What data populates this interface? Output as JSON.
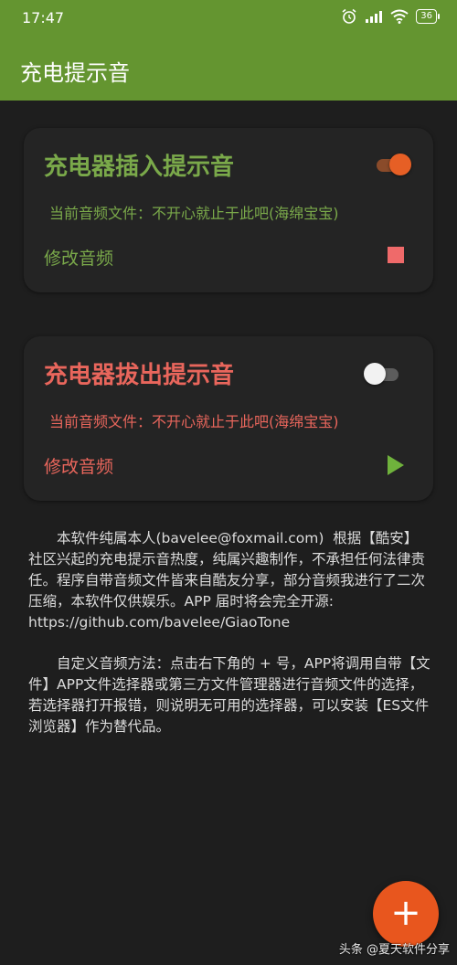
{
  "status_bar": {
    "time": "17:47",
    "alarm_icon": "alarm-icon",
    "signal_icon": "signal-icon",
    "wifi_icon": "wifi-icon",
    "battery": "36"
  },
  "app_bar": {
    "title": "充电提示音",
    "color": "#649530"
  },
  "cards": [
    {
      "title": "充电器插入提示音",
      "file": "当前音频文件：不开心就止于此吧(海绵宝宝)",
      "modify": "修改音频",
      "switch_on": true,
      "action_icon": "stop-icon",
      "accent": "#7aa94a"
    },
    {
      "title": "充电器拔出提示音",
      "file": "当前音频文件：不开心就止于此吧(海绵宝宝)",
      "modify": "修改音频",
      "switch_on": false,
      "action_icon": "play-icon",
      "accent": "#e9665c"
    }
  ],
  "description": {
    "para1": "本软件纯属本人(bavelee@foxmail.com)  根据【酷安】社区兴起的充电提示音热度，纯属兴趣制作，不承担任何法律责任。程序自带音频文件皆来自酷友分享，部分音频我进行了二次压缩，本软件仅供娱乐。APP 届时将会完全开源:",
    "url": "https://github.com/bavelee/GiaoTone",
    "para2": "自定义音频方法：点击右下角的 + 号，APP将调用自带【文件】APP文件选择器或第三方文件管理器进行音频文件的选择，若选择器打开报错，则说明无可用的选择器，可以安装【ES文件浏览器】作为替代品。"
  },
  "fab": {
    "label": "+",
    "color": "#e8561e"
  },
  "watermark": "头条 @夏天软件分享"
}
